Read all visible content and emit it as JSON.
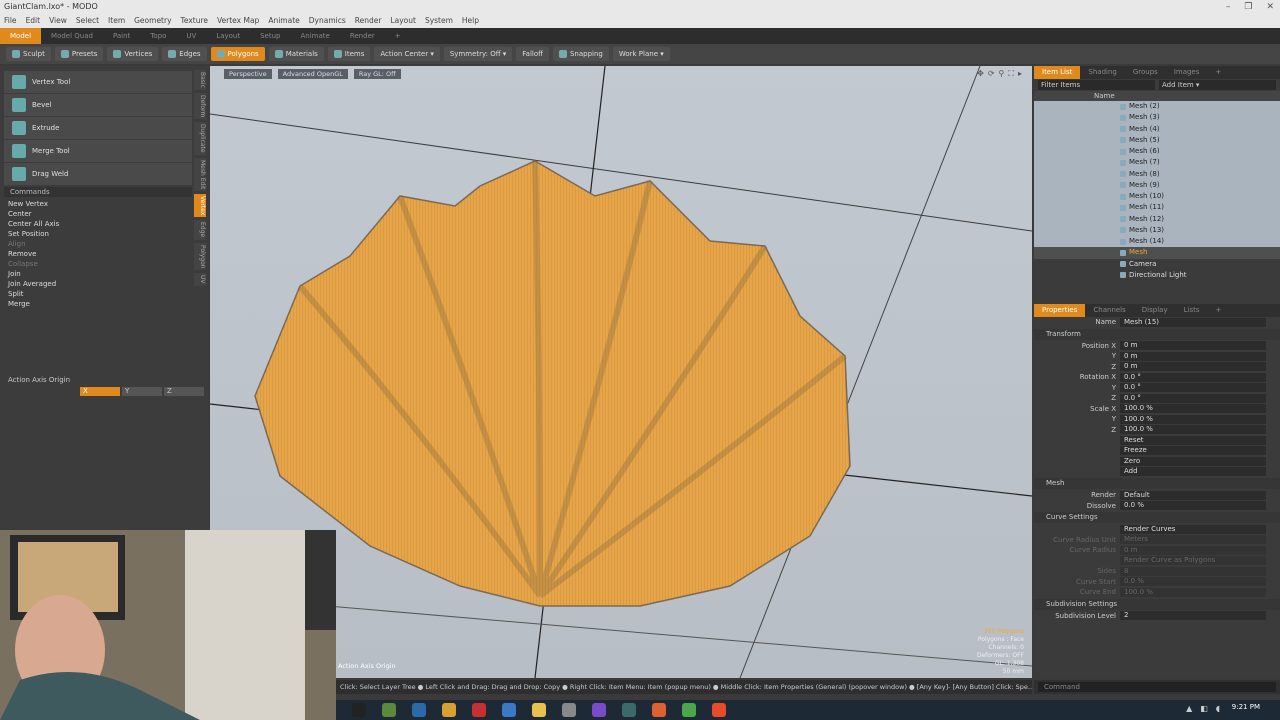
{
  "window": {
    "title": "GiantClam.lxo* - MODO",
    "min": "–",
    "max": "❐",
    "close": "✕"
  },
  "menu": [
    "File",
    "Edit",
    "View",
    "Select",
    "Item",
    "Geometry",
    "Texture",
    "Vertex Map",
    "Animate",
    "Dynamics",
    "Render",
    "Layout",
    "System",
    "Help"
  ],
  "layouts": [
    "Model",
    "Model Quad",
    "Paint",
    "Topo",
    "UV",
    "Layout",
    "Setup",
    "Animate",
    "Render",
    "+"
  ],
  "toolbar": {
    "sculpt": "Sculpt",
    "presets": "Presets",
    "vertices": "Vertices",
    "edges": "Edges",
    "polygons": "Polygons",
    "materials": "Materials",
    "items": "Items",
    "action_center": "Action Center ▾",
    "symmetry": "Symmetry: Off ▾",
    "falloff": "Falloff",
    "snapping": "Snapping",
    "work_plane": "Work Plane ▾"
  },
  "tools": [
    "Vertex Tool",
    "Bevel",
    "Extrude",
    "Merge Tool",
    "Drag Weld"
  ],
  "commands_label": "Commands",
  "commands": [
    {
      "label": "New Vertex",
      "dim": false
    },
    {
      "label": "Center",
      "dim": false
    },
    {
      "label": "Center All Axis",
      "dim": false
    },
    {
      "label": "Set Position",
      "dim": false
    },
    {
      "label": "Align",
      "dim": true
    },
    {
      "label": "Remove",
      "dim": false
    },
    {
      "label": "Collapse",
      "dim": true
    },
    {
      "label": "Join",
      "dim": false
    },
    {
      "label": "Join Averaged",
      "dim": false
    },
    {
      "label": "Split",
      "dim": false
    },
    {
      "label": "Merge",
      "dim": false
    }
  ],
  "side_tabs": [
    "Basic",
    "Deform",
    "Duplicate",
    "Mesh Edit",
    "Vertex",
    "Edge",
    "Polygon",
    "UV"
  ],
  "action_axis": {
    "title": "Action Axis Origin",
    "label": "Axis",
    "x": "X",
    "y": "Y",
    "z": "Z"
  },
  "viewport": {
    "view": "Perspective",
    "shading": "Advanced OpenGL",
    "raygl": "Ray GL: Off",
    "polycount": "280 Polygons",
    "poly_mode": "Polygons : Face",
    "channels": "Channels: 0",
    "deformers": "Deformers: OFF",
    "gl": "GL: 1,308",
    "scale": "50 mm",
    "axis_label": "Action Axis Origin"
  },
  "itemlist": {
    "tabs": [
      "Item List",
      "Shading",
      "Groups",
      "Images",
      "+"
    ],
    "filter": "Filter Items",
    "add": "Add Item ▾",
    "col": "Name",
    "rows": [
      "Mesh (2)",
      "Mesh (3)",
      "Mesh (4)",
      "Mesh (5)",
      "Mesh (6)",
      "Mesh (7)",
      "Mesh (8)",
      "Mesh (9)",
      "Mesh (10)",
      "Mesh (11)",
      "Mesh (12)",
      "Mesh (13)",
      "Mesh (14)",
      "Mesh",
      "Camera",
      "Directional Light"
    ]
  },
  "properties": {
    "tabs": [
      "Properties",
      "Channels",
      "Display",
      "Lists",
      "+"
    ],
    "name_label": "Name",
    "name": "Mesh (15)",
    "transform": "Transform",
    "position_label": "Position X",
    "pos": [
      "0 m",
      "0 m",
      "0 m"
    ],
    "rotation_label": "Rotation X",
    "rot": [
      "0.0 °",
      "0.0 °",
      "0.0 °"
    ],
    "scale_label": "Scale X",
    "scl": [
      "100.0 %",
      "100.0 %",
      "100.0 %"
    ],
    "y": "Y",
    "z": "Z",
    "actions": [
      "Reset",
      "Freeze",
      "Zero",
      "Add"
    ],
    "mesh": "Mesh",
    "render_label": "Render",
    "render": "Default",
    "dissolve_label": "Dissolve",
    "dissolve": "0.0 %",
    "curve": "Curve Settings",
    "render_curves": "Render Curves",
    "crunit_label": "Curve Radius Unit",
    "crunit": "Meters",
    "cr_label": "Curve Radius",
    "cr": "0 m",
    "rcp": "Render Curve as Polygons",
    "sides_label": "Sides",
    "sides": "8",
    "cstart_label": "Curve Start",
    "cstart": "0.0 %",
    "cend_label": "Curve End",
    "cend": "100.0 %",
    "subdiv": "Subdivision Settings",
    "sublevel_label": "Subdivision Level",
    "sublevel": "2"
  },
  "command_input": "Command",
  "hint": "Click: Select Layer Tree ● Left Click and Drag: Drag and Drop: Copy ● Right Click: Item Menu: Item (popup menu) ● Middle Click: Item Properties (General) (popover window) ● [Any Key]- [Any Button] Click: Spe...",
  "clock": "9:21 PM",
  "colors": {
    "accent": "#e08a1e",
    "mesh": "#f2a43a"
  }
}
